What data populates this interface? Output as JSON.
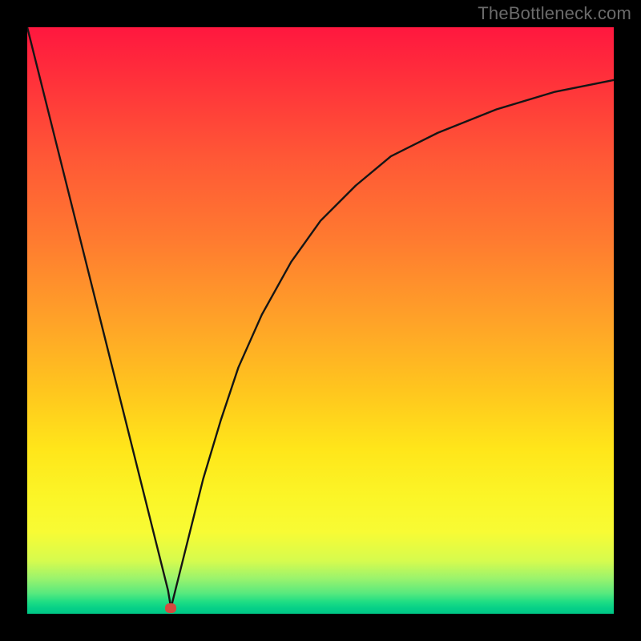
{
  "watermark": "TheBottleneck.com",
  "marker": {
    "x_pct": 24.5,
    "y_pct": 99.0
  },
  "colors": {
    "frame": "#000000",
    "curve": "#151515",
    "marker": "#d44a3f",
    "watermark": "#6b6b6b"
  },
  "chart_data": {
    "type": "line",
    "title": "",
    "xlabel": "",
    "ylabel": "",
    "xlim": [
      0,
      100
    ],
    "ylim": [
      0,
      100
    ],
    "annotations": [
      "TheBottleneck.com"
    ],
    "grid": false,
    "legend": false,
    "background_gradient": {
      "orientation": "vertical",
      "stops": [
        {
          "pos": 0,
          "color": "#ff173f"
        },
        {
          "pos": 50,
          "color": "#ffa228"
        },
        {
          "pos": 80,
          "color": "#fbf527"
        },
        {
          "pos": 100,
          "color": "#00c887"
        }
      ]
    },
    "marker_point": {
      "x": 24.5,
      "y": 1
    },
    "series": [
      {
        "name": "bottleneck-curve",
        "x": [
          0,
          4,
          8,
          12,
          16,
          20,
          22,
          24,
          24.5,
          25,
          26,
          28,
          30,
          33,
          36,
          40,
          45,
          50,
          56,
          62,
          70,
          80,
          90,
          100
        ],
        "y": [
          100,
          84,
          68,
          52,
          36,
          20,
          12,
          4,
          1,
          3,
          7,
          15,
          23,
          33,
          42,
          51,
          60,
          67,
          73,
          78,
          82,
          86,
          89,
          91
        ]
      }
    ]
  }
}
